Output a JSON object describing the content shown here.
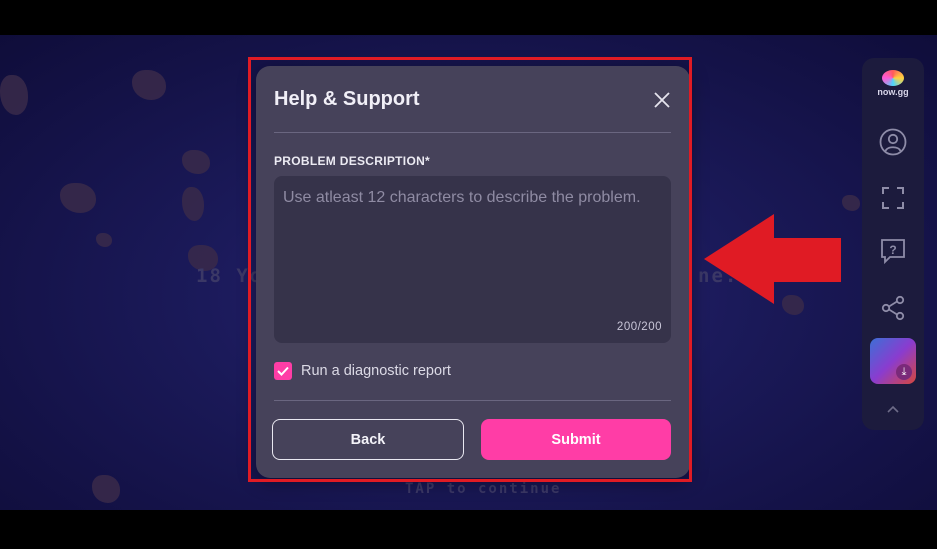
{
  "dialog": {
    "title": "Help & Support",
    "close_icon": "close-icon",
    "field_label": "PROBLEM DESCRIPTION*",
    "placeholder": "Use atleast 12 characters to describe the problem.",
    "value": "",
    "counter": "200/200",
    "checkbox_label": "Run a diagnostic report",
    "checkbox_checked": true,
    "back_label": "Back",
    "submit_label": "Submit"
  },
  "background": {
    "partial_text_left": "18 Yo",
    "partial_text_right": "ne.",
    "bottom_text": "TAP to continue"
  },
  "sidebar": {
    "logo_text": "now.gg",
    "icons": [
      "user-icon",
      "fullscreen-icon",
      "help-icon",
      "share-icon",
      "download-icon",
      "chevron-up-icon"
    ]
  },
  "colors": {
    "accent": "#ff3da6",
    "dialog_bg": "#46425a",
    "highlight": "#e01b24"
  }
}
